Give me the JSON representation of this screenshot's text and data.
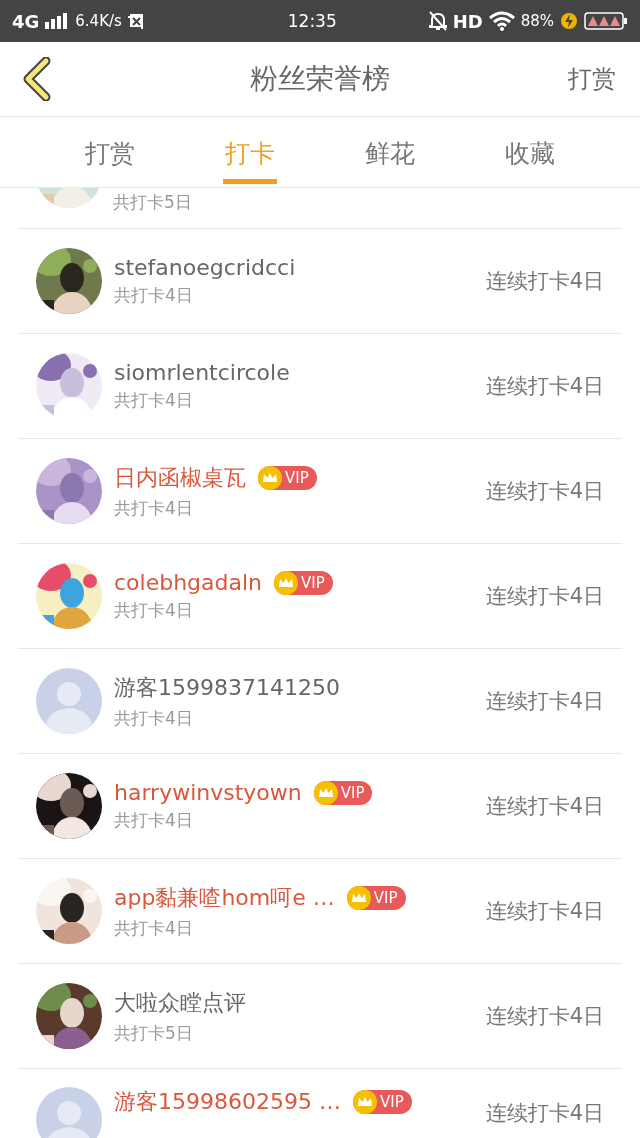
{
  "status_bar": {
    "network": "4G",
    "speed": "6.4K/s",
    "time": "12:35",
    "hd": "HD",
    "battery": "88%"
  },
  "header": {
    "title": "粉丝荣誉榜",
    "action": "打赏"
  },
  "tabs": [
    {
      "label": "打赏",
      "selected": false
    },
    {
      "label": "打卡",
      "selected": true
    },
    {
      "label": "鲜花",
      "selected": false
    },
    {
      "label": "收藏",
      "selected": false
    }
  ],
  "list": {
    "partial_row": {
      "count": "共打卡5日"
    },
    "rows": [
      {
        "name": "stefanoegcridcci",
        "vip": false,
        "count": "共打卡4日",
        "streak": "连续打卡4日"
      },
      {
        "name": "siomrlentcircole",
        "vip": false,
        "count": "共打卡4日",
        "streak": "连续打卡4日"
      },
      {
        "name": "日内函椒桌瓦",
        "vip": true,
        "badge": "VIP",
        "count": "共打卡4日",
        "streak": "连续打卡4日"
      },
      {
        "name": "colebhgadaln",
        "vip": true,
        "badge": "VIP",
        "count": "共打卡4日",
        "streak": "连续打卡4日"
      },
      {
        "avatar": {
          "kind": "default"
        },
        "name": "游客1599837141250",
        "vip": false,
        "count": "共打卡4日",
        "streak": "连续打卡4日"
      },
      {
        "name": "harrywinvstyown",
        "vip": true,
        "badge": "VIP",
        "count": "共打卡4日",
        "streak": "连续打卡4日"
      },
      {
        "name": "app黏兼喳hom呵e …",
        "vip": true,
        "badge": "VIP",
        "count": "共打卡4日",
        "streak": "连续打卡4日"
      },
      {
        "name": "大啦众瞠点评",
        "vip": false,
        "count": "共打卡5日",
        "streak": "连续打卡4日"
      },
      {
        "avatar": {
          "kind": "default"
        },
        "name": "游客15998602595 …",
        "vip": true,
        "badge": "VIP",
        "streak": "连续打卡4日"
      }
    ]
  }
}
